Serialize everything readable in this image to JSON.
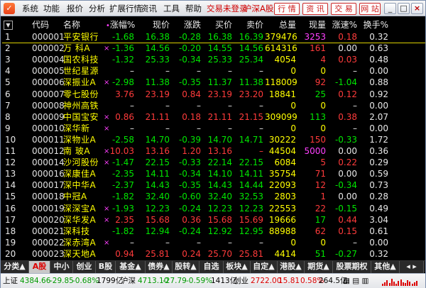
{
  "menubar": {
    "items": [
      "系统",
      "功能",
      "报价",
      "分析",
      "扩展行情",
      "资讯",
      "工具",
      "帮助"
    ],
    "status_items": [
      "交易未登录",
      "沪深A股"
    ],
    "buttons": [
      "行 情",
      "资 讯",
      "交 易",
      "网 站"
    ],
    "window_controls": [
      "_",
      "□",
      "×"
    ]
  },
  "table": {
    "headers": [
      "代码",
      "名称",
      "涨幅%",
      "现价",
      "涨跌",
      "买价",
      "卖价",
      "总量",
      "现量",
      "涨速%",
      "换手%"
    ],
    "sort_marker": "•",
    "rows": [
      {
        "seq": "1",
        "code": "000001",
        "name": "平安银行",
        "mark": "",
        "chg_pct": "-1.68",
        "price": "16.38",
        "chg": "-0.28",
        "bid": "16.38",
        "ask": "16.39",
        "volume": "379476",
        "cur_vol": "3253",
        "speed": "0.18",
        "turnover": "0.32",
        "dir": "dn",
        "speed_dir": "up"
      },
      {
        "seq": "2",
        "code": "000002",
        "name": "万 科A",
        "mark": "×",
        "chg_pct": "-1.36",
        "price": "14.56",
        "chg": "-0.20",
        "bid": "14.55",
        "ask": "14.56",
        "volume": "614316",
        "cur_vol": "161",
        "speed": "0.00",
        "turnover": "0.63",
        "dir": "dn",
        "speed_dir": "flat"
      },
      {
        "seq": "3",
        "code": "000004",
        "name": "国农科技",
        "mark": "",
        "chg_pct": "-1.32",
        "price": "25.33",
        "chg": "-0.34",
        "bid": "25.33",
        "ask": "25.34",
        "volume": "4054",
        "cur_vol": "4",
        "speed": "0.03",
        "turnover": "0.48",
        "dir": "dn",
        "speed_dir": "up"
      },
      {
        "seq": "4",
        "code": "000005",
        "name": "世纪星源",
        "mark": "",
        "chg_pct": "–",
        "price": "–",
        "chg": "–",
        "bid": "–",
        "ask": "–",
        "volume": "0",
        "cur_vol": "0",
        "speed": "–",
        "turnover": "0.00",
        "dir": "flat",
        "speed_dir": "flat"
      },
      {
        "seq": "5",
        "code": "000006",
        "name": "深振业A",
        "mark": "×",
        "chg_pct": "-2.98",
        "price": "11.38",
        "chg": "-0.35",
        "bid": "11.37",
        "ask": "11.38",
        "volume": "118009",
        "cur_vol": "92",
        "speed": "-1.04",
        "turnover": "0.88",
        "dir": "dn",
        "speed_dir": "dn"
      },
      {
        "seq": "6",
        "code": "000007",
        "name": "零七股份",
        "mark": "",
        "chg_pct": "3.76",
        "price": "23.19",
        "chg": "0.84",
        "bid": "23.19",
        "ask": "23.20",
        "volume": "18841",
        "cur_vol": "25",
        "speed": "0.12",
        "turnover": "0.92",
        "dir": "up",
        "speed_dir": "up"
      },
      {
        "seq": "7",
        "code": "000008",
        "name": "神州高铁",
        "mark": "",
        "chg_pct": "–",
        "price": "–",
        "chg": "–",
        "bid": "–",
        "ask": "–",
        "volume": "0",
        "cur_vol": "0",
        "speed": "–",
        "turnover": "0.00",
        "dir": "flat",
        "speed_dir": "flat"
      },
      {
        "seq": "8",
        "code": "000009",
        "name": "中国宝安",
        "mark": "×",
        "chg_pct": "0.86",
        "price": "21.11",
        "chg": "0.18",
        "bid": "21.11",
        "ask": "21.15",
        "volume": "309099",
        "cur_vol": "113",
        "speed": "0.38",
        "turnover": "2.07",
        "dir": "up",
        "speed_dir": "up"
      },
      {
        "seq": "9",
        "code": "000010",
        "name": "深华新",
        "mark": "×",
        "chg_pct": "–",
        "price": "–",
        "chg": "–",
        "bid": "–",
        "ask": "–",
        "volume": "0",
        "cur_vol": "0",
        "speed": "–",
        "turnover": "0.00",
        "dir": "flat",
        "speed_dir": "flat"
      },
      {
        "seq": "10",
        "code": "000011",
        "name": "深物业A",
        "mark": "",
        "chg_pct": "-2.58",
        "price": "14.70",
        "chg": "-0.39",
        "bid": "14.70",
        "ask": "14.71",
        "volume": "30222",
        "cur_vol": "150",
        "speed": "-0.33",
        "turnover": "1.72",
        "dir": "dn",
        "speed_dir": "dn"
      },
      {
        "seq": "11",
        "code": "000012",
        "name": "南 玻A",
        "mark": "×",
        "chg_pct": "10.03",
        "price": "13.16",
        "chg": "1.20",
        "bid": "13.16",
        "ask": "–",
        "volume": "44504",
        "cur_vol": "5000",
        "speed": "0.00",
        "turnover": "0.36",
        "dir": "up",
        "speed_dir": "flat"
      },
      {
        "seq": "12",
        "code": "000014",
        "name": "沙河股份",
        "mark": "×",
        "chg_pct": "-1.47",
        "price": "22.15",
        "chg": "-0.33",
        "bid": "22.14",
        "ask": "22.15",
        "volume": "6084",
        "cur_vol": "5",
        "speed": "0.22",
        "turnover": "0.29",
        "dir": "dn",
        "speed_dir": "up"
      },
      {
        "seq": "13",
        "code": "000016",
        "name": "深康佳A",
        "mark": "",
        "chg_pct": "-2.35",
        "price": "14.11",
        "chg": "-0.34",
        "bid": "14.10",
        "ask": "14.11",
        "volume": "35754",
        "cur_vol": "71",
        "speed": "0.00",
        "turnover": "0.59",
        "dir": "dn",
        "speed_dir": "flat"
      },
      {
        "seq": "14",
        "code": "000017",
        "name": "深中华A",
        "mark": "",
        "chg_pct": "-2.37",
        "price": "14.43",
        "chg": "-0.35",
        "bid": "14.43",
        "ask": "14.44",
        "volume": "22093",
        "cur_vol": "12",
        "speed": "-0.34",
        "turnover": "0.73",
        "dir": "dn",
        "speed_dir": "dn"
      },
      {
        "seq": "15",
        "code": "000018",
        "name": "中冠A",
        "mark": "",
        "chg_pct": "-1.82",
        "price": "32.40",
        "chg": "-0.60",
        "bid": "32.40",
        "ask": "32.53",
        "volume": "2803",
        "cur_vol": "1",
        "speed": "0.00",
        "turnover": "0.28",
        "dir": "dn",
        "speed_dir": "flat"
      },
      {
        "seq": "16",
        "code": "000019",
        "name": "深深宝A",
        "mark": "×",
        "chg_pct": "-1.93",
        "price": "12.23",
        "chg": "-0.24",
        "bid": "12.23",
        "ask": "12.23",
        "volume": "22553",
        "cur_vol": "22",
        "speed": "-0.15",
        "turnover": "0.49",
        "dir": "dn",
        "speed_dir": "dn"
      },
      {
        "seq": "17",
        "code": "000020",
        "name": "深华发A",
        "mark": "×",
        "chg_pct": "2.35",
        "price": "15.68",
        "chg": "0.36",
        "bid": "15.68",
        "ask": "15.69",
        "volume": "19666",
        "cur_vol": "17",
        "speed": "0.44",
        "turnover": "3.04",
        "dir": "up",
        "speed_dir": "up"
      },
      {
        "seq": "18",
        "code": "000021",
        "name": "深科技",
        "mark": "",
        "chg_pct": "-1.82",
        "price": "12.94",
        "chg": "-0.24",
        "bid": "12.92",
        "ask": "12.95",
        "volume": "88988",
        "cur_vol": "62",
        "speed": "0.15",
        "turnover": "0.61",
        "dir": "dn",
        "speed_dir": "up"
      },
      {
        "seq": "19",
        "code": "000022",
        "name": "深赤湾A",
        "mark": "×",
        "chg_pct": "–",
        "price": "–",
        "chg": "–",
        "bid": "–",
        "ask": "–",
        "volume": "0",
        "cur_vol": "0",
        "speed": "–",
        "turnover": "0.00",
        "dir": "flat",
        "speed_dir": "flat"
      },
      {
        "seq": "20",
        "code": "000023",
        "name": "深天地A",
        "mark": "",
        "chg_pct": "0.94",
        "price": "25.81",
        "chg": "0.24",
        "bid": "25.70",
        "ask": "25.81",
        "volume": "4414",
        "cur_vol": "51",
        "speed": "-0.27",
        "turnover": "0.32",
        "dir": "up",
        "speed_dir": "dn"
      }
    ]
  },
  "tabs": [
    "分类▲",
    "A股",
    "中小",
    "创业",
    "B股",
    "基金▲",
    "债券▲",
    "股转▲",
    "自选",
    "板块▲",
    "自定▲",
    "港股▲",
    "期货▲",
    "股票期权",
    "其他▲"
  ],
  "active_tab": 1,
  "status": {
    "sh_label": "上证",
    "sh_value": "4384.66",
    "sh_chg": "-29.85",
    "sh_pct": "-0.68%",
    "sh_amount": "1799亿",
    "hs_label": "沪深",
    "hs_value": "4713.10",
    "hs_chg": "-27.79",
    "hs_pct": "-0.59%",
    "hs_amount": "1413亿",
    "cy_label": "创业",
    "cy_value": "2722.00",
    "cy_chg": "15.81",
    "cy_pct": "0.58%",
    "cy_amount": "264.5亿"
  }
}
